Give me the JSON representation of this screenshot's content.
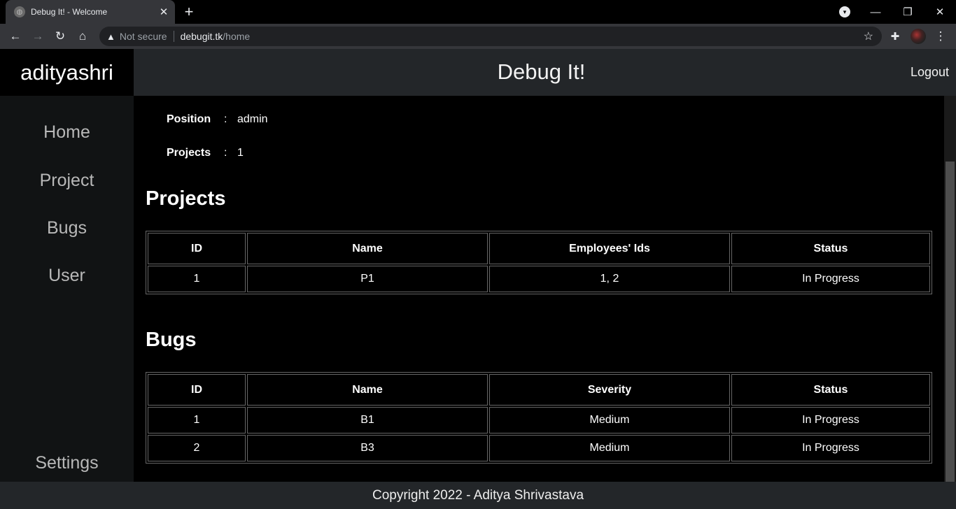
{
  "browser": {
    "tab_title": "Debug It! - Welcome",
    "tab_close": "✕",
    "new_tab": "+",
    "address": {
      "security_label": "Not secure",
      "host": "debugit.tk",
      "path": "/home"
    },
    "icons": {
      "back": "arrow-left-icon",
      "forward": "arrow-right-icon",
      "reload": "reload-icon",
      "home": "home-icon",
      "star": "star-icon",
      "extensions": "puzzle-icon",
      "menu": "kebab-icon"
    }
  },
  "header": {
    "brand": "adityashri",
    "title": "Debug It!",
    "logout": "Logout"
  },
  "sidebar": {
    "items": [
      {
        "label": "Home"
      },
      {
        "label": "Project"
      },
      {
        "label": "Bugs"
      },
      {
        "label": "User"
      }
    ],
    "settings": "Settings"
  },
  "profile": {
    "position_label": "Position",
    "position_value": "admin",
    "projects_label": "Projects",
    "projects_value": "1",
    "colon": ":"
  },
  "projects": {
    "title": "Projects",
    "headers": [
      "ID",
      "Name",
      "Employees' Ids",
      "Status"
    ],
    "rows": [
      [
        "1",
        "P1",
        "1, 2",
        "In Progress"
      ]
    ]
  },
  "bugs": {
    "title": "Bugs",
    "headers": [
      "ID",
      "Name",
      "Severity",
      "Status"
    ],
    "rows": [
      [
        "1",
        "B1",
        "Medium",
        "In Progress"
      ],
      [
        "2",
        "B3",
        "Medium",
        "In Progress"
      ]
    ]
  },
  "footer": {
    "text": "Copyright 2022 - Aditya Shrivastava"
  }
}
